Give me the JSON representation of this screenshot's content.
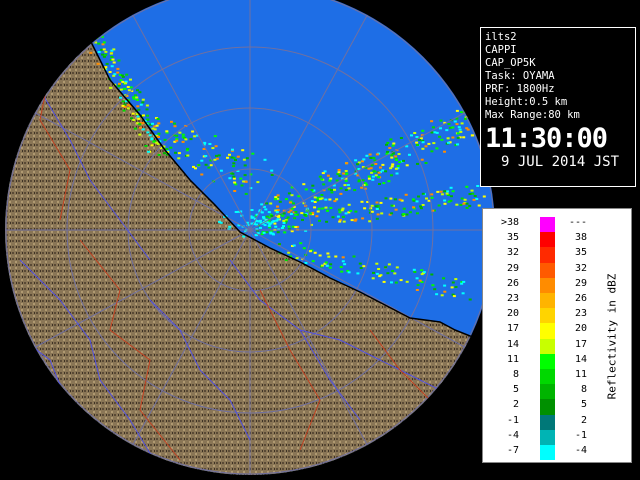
{
  "info": {
    "lines": [
      "ilts2",
      "CAPPI",
      "CAP_OP5K",
      "Task: OYAMA",
      "PRF: 1800Hz",
      "Height:0.5 km",
      "Max Range:80 km"
    ],
    "time": "11:30:00",
    "date": "9 JUL 2014 JST"
  },
  "legend": {
    "title": "Reflectivity in dBZ",
    "rows": [
      {
        "lo": ">38",
        "hi": "---",
        "color": "#ff00ff"
      },
      {
        "lo": "35",
        "hi": "38",
        "color": "#ff0000"
      },
      {
        "lo": "32",
        "hi": "35",
        "color": "#ff2a00"
      },
      {
        "lo": "29",
        "hi": "32",
        "color": "#ff5a00"
      },
      {
        "lo": "26",
        "hi": "29",
        "color": "#ff8c00"
      },
      {
        "lo": "23",
        "hi": "26",
        "color": "#ffb400"
      },
      {
        "lo": "20",
        "hi": "23",
        "color": "#ffd400"
      },
      {
        "lo": "17",
        "hi": "20",
        "color": "#ffff00"
      },
      {
        "lo": "14",
        "hi": "17",
        "color": "#c8ff00"
      },
      {
        "lo": "11",
        "hi": "14",
        "color": "#00ff00"
      },
      {
        "lo": "8",
        "hi": "11",
        "color": "#00d800"
      },
      {
        "lo": "5",
        "hi": "8",
        "color": "#00b400"
      },
      {
        "lo": "2",
        "hi": "5",
        "color": "#009000"
      },
      {
        "lo": "-1",
        "hi": "2",
        "color": "#007878"
      },
      {
        "lo": "-4",
        "hi": "-1",
        "color": "#00b4b4"
      },
      {
        "lo": "-7",
        "hi": "-4",
        "color": "#00ffff"
      }
    ]
  },
  "map": {
    "sea_color": "#1e6ee6",
    "land_color": "#8a7656",
    "range_ring_color": "#7070a0",
    "river_color": "#5050e0",
    "boundary_color": "#c04020"
  }
}
